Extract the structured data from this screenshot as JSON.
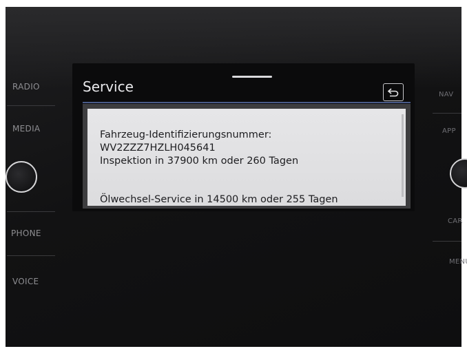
{
  "hardware": {
    "left_buttons": [
      "RADIO",
      "MEDIA",
      "PHONE",
      "VOICE"
    ],
    "right_buttons": [
      "NAV",
      "APP",
      "CAR",
      "MENU"
    ]
  },
  "screen": {
    "title": "Service",
    "back_icon": "back-arrow-icon",
    "accent_color": "#4a5b8a"
  },
  "popup": {
    "label_vin": "Fahrzeug-Identifizierungsnummer:",
    "vin": "WV2ZZZ7HZLH045641",
    "inspection": "Inspektion in 37900 km oder 260 Tagen",
    "oil_service": "Ölwechsel-Service in 14500 km oder 255 Tagen"
  }
}
